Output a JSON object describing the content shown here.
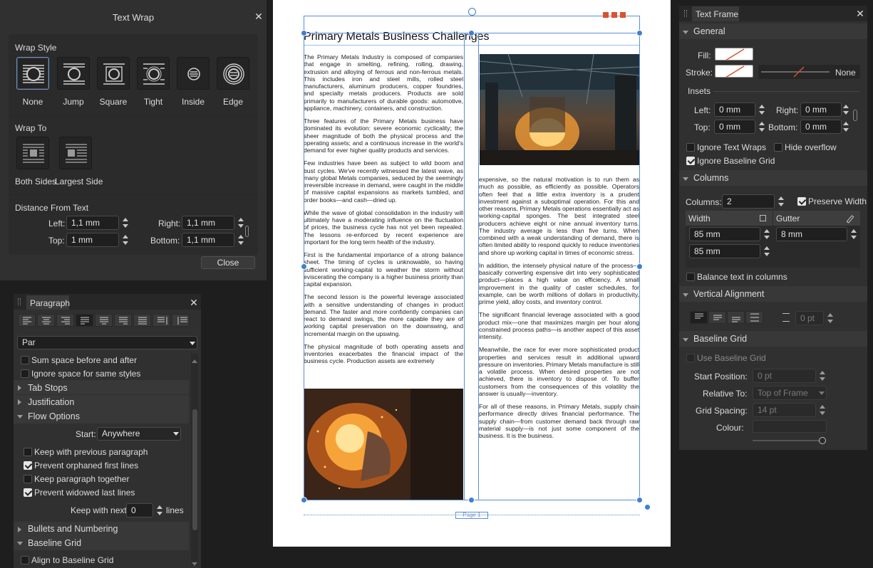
{
  "text_wrap_panel": {
    "title": "Text Wrap",
    "wrap_style_heading": "Wrap Style",
    "wrap_styles": [
      "None",
      "Jump",
      "Square",
      "Tight",
      "Inside",
      "Edge"
    ],
    "selected_wrap_style": "None",
    "wrap_to_heading": "Wrap To",
    "wrap_to": [
      "Both Sides",
      "Largest Side"
    ],
    "distance_heading": "Distance From Text",
    "left_label": "Left:",
    "left_value": "1,1 mm",
    "right_label": "Right:",
    "right_value": "1,1 mm",
    "top_label": "Top:",
    "top_value": "1 mm",
    "bottom_label": "Bottom:",
    "bottom_value": "1,1 mm",
    "close_label": "Close"
  },
  "paragraph_panel": {
    "tab_label": "Paragraph",
    "style_value": "Par",
    "sum_space": "Sum space before and after",
    "ignore_space": "Ignore space for same styles",
    "tab_stops": "Tab Stops",
    "justification": "Justification",
    "flow_options": "Flow Options",
    "start_label": "Start:",
    "start_value": "Anywhere",
    "keep_previous": "Keep with previous paragraph",
    "prevent_orphaned": "Prevent orphaned first lines",
    "keep_together": "Keep paragraph together",
    "prevent_widowed": "Prevent widowed last lines",
    "keep_next_label": "Keep with next:",
    "keep_next_value": "0",
    "lines_label": "lines",
    "bullets": "Bullets and Numbering",
    "baseline_grid": "Baseline Grid",
    "align_baseline": "Align to Baseline Grid"
  },
  "text_frame_panel": {
    "tab_label": "Text Frame",
    "general": "General",
    "fill_label": "Fill:",
    "stroke_label": "Stroke:",
    "stroke_style": "None",
    "insets": "Insets",
    "left_label": "Left:",
    "left_value": "0 mm",
    "right_label": "Right:",
    "right_value": "0 mm",
    "top_label": "Top:",
    "top_value": "0 mm",
    "bottom_label": "Bottom:",
    "bottom_value": "0 mm",
    "ignore_text_wraps": "Ignore Text Wraps",
    "hide_overflow": "Hide overflow",
    "ignore_baseline_grid": "Ignore Baseline Grid",
    "columns_heading": "Columns",
    "columns_label": "Columns:",
    "columns_value": "2",
    "preserve_width": "Preserve Width",
    "width_header": "Width",
    "gutter_header": "Gutter",
    "width_1": "85 mm",
    "gutter_1": "8 mm",
    "width_2": "85 mm",
    "balance_text": "Balance text in columns",
    "vertical_alignment": "Vertical Alignment",
    "valign_value": "0 pt",
    "baseline_grid_heading": "Baseline Grid",
    "use_baseline_grid": "Use Baseline Grid",
    "start_position_label": "Start Position:",
    "start_position_value": "0 pt",
    "relative_to_label": "Relative To:",
    "relative_to_value": "Top of Frame",
    "grid_spacing_label": "Grid Spacing:",
    "grid_spacing_value": "14 pt",
    "colour_label": "Colour:"
  },
  "document": {
    "title": "Primary Metals Business Challenges",
    "page_label": "Page 1",
    "col1": [
      "The Primary Metals Industry is composed of companies that engage in smelting, refining, rolling, drawing, extrusion and alloying of ferrous and non-ferrous metals. This includes iron and steel mills, rolled steel manufacturers, aluminum producers, copper foundries, and specialty metals producers. Products are sold primarily to manufacturers of durable goods: automotive, appliance, machinery, containers, and construction.",
      "Three features of the Primary Metals business have dominated its evolution: severe economic cyclicality; the sheer magnitude of both the physical process and the operating assets; and a continuous increase in the world's demand for ever higher quality products and services.",
      "Few industries have been as subject to wild boom and bust cycles. We've recently witnessed the latest wave, as many global Metals companies, seduced by the seemingly irreversible increase in demand, were caught in the middle of massive capital expansions as markets tumbled, and order books—and cash—dried up.",
      "While the wave of global consolidation in the industry will ultimately have a moderating influence on the fluctuation of prices, the business cycle has not yet been repealed. The lessons re-enforced by recent experience are important for the long term health of the industry.",
      "First is the fundamental importance of a strong balance sheet. The timing of cycles is unknowable, so having sufficient working-capital to weather the storm without eviscerating the company is a higher business priority than capital expansion.",
      "The second lesson is the powerful leverage associated with a sensitive understanding of changes in product demand. The faster and more confidently companies can react to demand swings, the more capable they are of working capital preservation on the downswing, and incremental margin on the upswing.",
      "The physical magnitude of both operating assets and inventories exacerbates the financial impact of the business cycle. Production assets are extremely"
    ],
    "col2": [
      "expensive, so the natural motivation is to run them as much as possible, as efficiently as possible. Operators often feel that a little extra inventory is a prudent investment against a suboptimal operation. For this and other reasons, Primary Metals operations essentially act as working-capital sponges. The best integrated steel producers achieve eight or nine annual inventory turns. The industry average is less than five turns. When combined with a weak understanding of demand, there is often limited ability to respond quickly to reduce inventories and shore up working capital in times of economic stress.",
      "In addition, the intensely physical nature of the process—basically converting expensive dirt into very sophisticated product—places a high value on efficiency. A small improvement in the quality of caster schedules, for example, can be worth millions of dollars in productivity, prime yield, alloy costs, and inventory control.",
      "The significant financial leverage associated with a good product mix—one that maximizes margin per hour along constrained process paths—is another aspect of this asset intensity.",
      "Meanwhile, the race for ever more sophisticated product properties and services result in additional upward pressure on inventories. Primary Metals manufacture is still a volatile process. When desired properties are not achieved, there is inventory to dispose of. To buffer customers from the consequences of this volatility the answer is usually—inventory.",
      "For all of these reasons, in Primary Metals, supply chain performance directly drives financial performance. The supply chain—from customer demand back through raw material supply—is not just some component of the business. It is the business."
    ]
  },
  "colors": {
    "panel": "#303030",
    "accent": "#3f7fd4",
    "orange": "#d9532b"
  }
}
